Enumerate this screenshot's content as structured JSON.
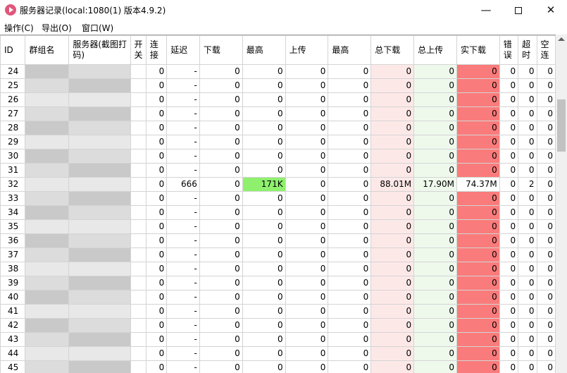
{
  "window": {
    "title": "服务器记录(local:1080(1) 版本4.9.2)"
  },
  "menu": [
    "操作(C)",
    "导出(O)",
    "窗口(W)"
  ],
  "colors": {
    "pink": "#fde8e8",
    "mint": "#eef9ec",
    "red": "#fa7b7b",
    "green": "#8ff06e"
  },
  "table": {
    "headers": [
      "ID",
      "群组名",
      "服务器(截图打码)",
      "开关",
      "连接",
      "延迟",
      "下载",
      "最高",
      "上传",
      "最高",
      "总下载",
      "总上传",
      "实下载",
      "错误",
      "超时",
      "空连"
    ],
    "rows": [
      [
        "24",
        "",
        "",
        "",
        "0",
        "-",
        "0",
        "0",
        "0",
        "0",
        "0",
        "0",
        "0",
        "0",
        "0",
        "0"
      ],
      [
        "25",
        "",
        "",
        "",
        "0",
        "-",
        "0",
        "0",
        "0",
        "0",
        "0",
        "0",
        "0",
        "0",
        "0",
        "0"
      ],
      [
        "26",
        "",
        "",
        "",
        "0",
        "-",
        "0",
        "0",
        "0",
        "0",
        "0",
        "0",
        "0",
        "0",
        "0",
        "0"
      ],
      [
        "27",
        "",
        "",
        "",
        "0",
        "-",
        "0",
        "0",
        "0",
        "0",
        "0",
        "0",
        "0",
        "0",
        "0",
        "0"
      ],
      [
        "28",
        "",
        "",
        "",
        "0",
        "-",
        "0",
        "0",
        "0",
        "0",
        "0",
        "0",
        "0",
        "0",
        "0",
        "0"
      ],
      [
        "29",
        "",
        "",
        "",
        "0",
        "-",
        "0",
        "0",
        "0",
        "0",
        "0",
        "0",
        "0",
        "0",
        "0",
        "0"
      ],
      [
        "30",
        "",
        "",
        "",
        "0",
        "-",
        "0",
        "0",
        "0",
        "0",
        "0",
        "0",
        "0",
        "0",
        "0",
        "0"
      ],
      [
        "31",
        "",
        "",
        "",
        "0",
        "-",
        "0",
        "0",
        "0",
        "0",
        "0",
        "0",
        "0",
        "0",
        "0",
        "0"
      ],
      [
        "32",
        "",
        "",
        "",
        "0",
        "666",
        "0",
        "171K",
        "0",
        "0",
        "88.01M",
        "17.90M",
        "74.37M",
        "0",
        "2",
        "0"
      ],
      [
        "33",
        "",
        "",
        "",
        "0",
        "-",
        "0",
        "0",
        "0",
        "0",
        "0",
        "0",
        "0",
        "0",
        "0",
        "0"
      ],
      [
        "34",
        "",
        "",
        "",
        "0",
        "-",
        "0",
        "0",
        "0",
        "0",
        "0",
        "0",
        "0",
        "0",
        "0",
        "0"
      ],
      [
        "35",
        "",
        "",
        "",
        "0",
        "-",
        "0",
        "0",
        "0",
        "0",
        "0",
        "0",
        "0",
        "0",
        "0",
        "0"
      ],
      [
        "36",
        "",
        "",
        "",
        "0",
        "-",
        "0",
        "0",
        "0",
        "0",
        "0",
        "0",
        "0",
        "0",
        "0",
        "0"
      ],
      [
        "37",
        "",
        "",
        "",
        "0",
        "-",
        "0",
        "0",
        "0",
        "0",
        "0",
        "0",
        "0",
        "0",
        "0",
        "0"
      ],
      [
        "38",
        "",
        "",
        "",
        "0",
        "-",
        "0",
        "0",
        "0",
        "0",
        "0",
        "0",
        "0",
        "0",
        "0",
        "0"
      ],
      [
        "39",
        "",
        "",
        "",
        "0",
        "-",
        "0",
        "0",
        "0",
        "0",
        "0",
        "0",
        "0",
        "0",
        "0",
        "0"
      ],
      [
        "40",
        "",
        "",
        "",
        "0",
        "-",
        "0",
        "0",
        "0",
        "0",
        "0",
        "0",
        "0",
        "0",
        "0",
        "0"
      ],
      [
        "41",
        "",
        "",
        "",
        "0",
        "-",
        "0",
        "0",
        "0",
        "0",
        "0",
        "0",
        "0",
        "0",
        "0",
        "0"
      ],
      [
        "42",
        "",
        "",
        "",
        "0",
        "-",
        "0",
        "0",
        "0",
        "0",
        "0",
        "0",
        "0",
        "0",
        "0",
        "0"
      ],
      [
        "43",
        "",
        "",
        "",
        "0",
        "-",
        "0",
        "0",
        "0",
        "0",
        "0",
        "0",
        "0",
        "0",
        "0",
        "0"
      ],
      [
        "44",
        "",
        "",
        "",
        "0",
        "-",
        "0",
        "0",
        "0",
        "0",
        "0",
        "0",
        "0",
        "0",
        "0",
        "0"
      ],
      [
        "45",
        "",
        "",
        "",
        "0",
        "-",
        "0",
        "0",
        "0",
        "0",
        "0",
        "0",
        "0",
        "0",
        "0",
        "0"
      ]
    ]
  }
}
